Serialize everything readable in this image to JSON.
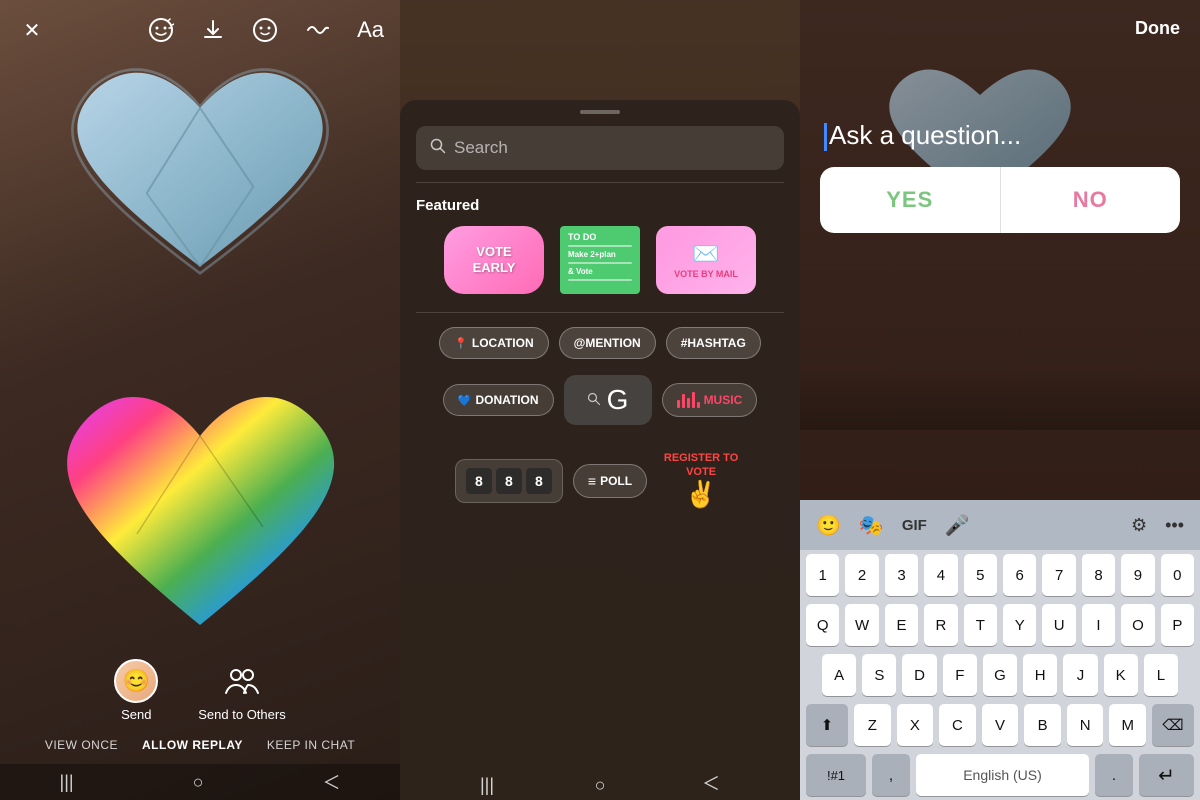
{
  "panel1": {
    "toolbar": {
      "close_label": "✕",
      "emoji_label": "☺",
      "download_label": "⬇",
      "face_label": "🙂",
      "squiggle_label": "〜",
      "text_label": "Aa"
    },
    "bottom": {
      "send_label": "Send",
      "send_others_label": "Send to Others",
      "view_once": "VIEW ONCE",
      "allow_replay": "ALLOW REPLAY",
      "keep_in_chat": "KEEP IN CHAT"
    },
    "nav": [
      "|||",
      "○",
      "＜"
    ]
  },
  "panel2": {
    "search_placeholder": "Search",
    "featured_label": "Featured",
    "stickers": {
      "vote_early": "VOTE EARLY",
      "todo_title": "TO DO",
      "todo_items": [
        "Make 2+plan",
        "& Vote"
      ],
      "vote_mail": "VOTE BY MAIL",
      "location": "LOCATION",
      "mention": "@MENTION",
      "hashtag": "#HASHTAG",
      "donation": "DONATION",
      "gif_letter": "G",
      "music": "MUSIC",
      "poll": "POLL",
      "register": "REGISTER TO VOTE"
    },
    "nav": [
      "|||",
      "○",
      "＜"
    ]
  },
  "panel3": {
    "done_label": "Done",
    "question_placeholder": "Ask a question...",
    "yes_label": "YES",
    "no_label": "NO",
    "keyboard": {
      "toolbar_icons": [
        "😊",
        "🎭",
        "GIF",
        "🎤",
        "⚙",
        "•••"
      ],
      "row_numbers": [
        "1",
        "2",
        "3",
        "4",
        "5",
        "6",
        "7",
        "8",
        "9",
        "0"
      ],
      "row_q": [
        "Q",
        "W",
        "E",
        "R",
        "T",
        "Y",
        "U",
        "I",
        "O",
        "P"
      ],
      "row_a": [
        "A",
        "S",
        "D",
        "F",
        "G",
        "H",
        "J",
        "K",
        "L"
      ],
      "row_z": [
        "Z",
        "X",
        "C",
        "V",
        "B",
        "N",
        "M"
      ],
      "special_left": "!#1",
      "comma": ",",
      "space": "English (US)",
      "period": ".",
      "return_icon": "↵"
    }
  }
}
